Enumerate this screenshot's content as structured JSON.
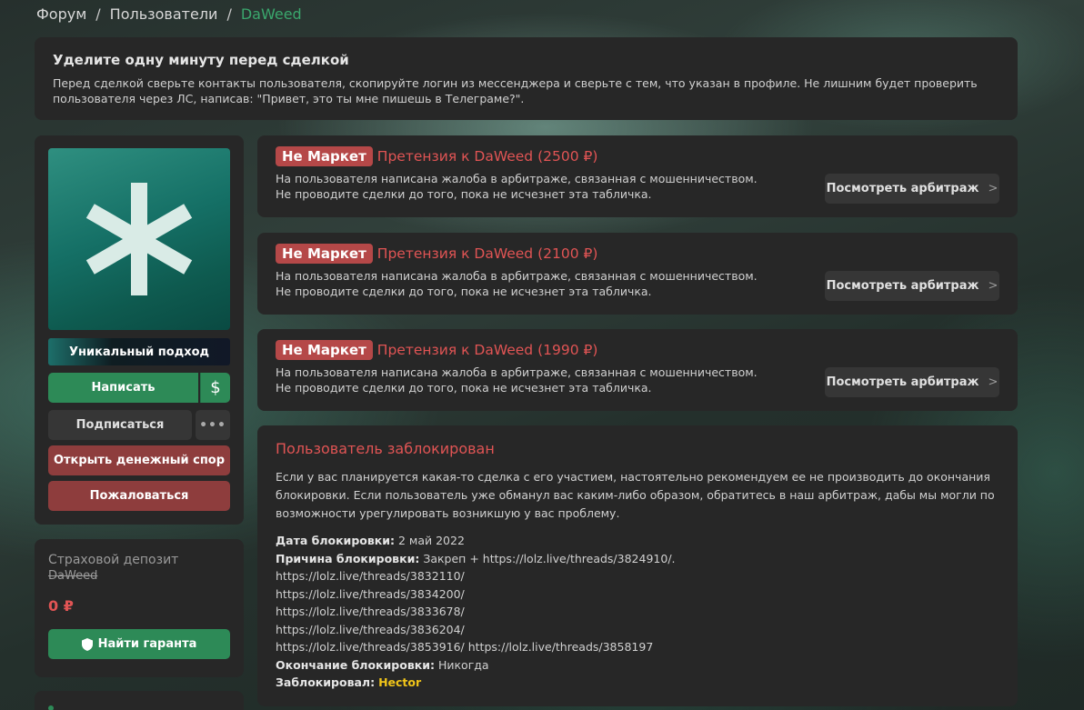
{
  "breadcrumb": {
    "items": [
      "Форум",
      "Пользователи"
    ],
    "current": "DaWeed",
    "separator": "/"
  },
  "notice": {
    "title": "Уделите одну минуту перед сделкой",
    "text": "Перед сделкой сверьте контакты пользователя, скопируйте логин из мессенджера и сверьте с тем, что указан в профиле. Не лишним будет проверить пользователя через ЛС, написав: \"Привет, это ты мне пишешь в Телеграме?\"."
  },
  "profile": {
    "user_title": "Уникальный подход",
    "write_label": "Написать",
    "dollar_label": "$",
    "subscribe_label": "Подписаться",
    "more_label": "•••",
    "dispute_label": "Открыть денежный спор",
    "report_label": "Пожаловаться"
  },
  "deposit": {
    "label": "Страховой депозит",
    "username": "DaWeed",
    "amount": "0 ₽",
    "guarant_label": "Найти гаранта"
  },
  "claims": [
    {
      "tag": "Не Маркет",
      "title": "Претензия к DaWeed (2500 ₽)",
      "line1": "На пользователя написана жалоба в арбитраже, связанная с мошенничеством.",
      "line2": "Не проводите сделки до того, пока не исчезнет эта табличка.",
      "button": "Посмотреть арбитраж"
    },
    {
      "tag": "Не Маркет",
      "title": "Претензия к DaWeed (2100 ₽)",
      "line1": "На пользователя написана жалоба в арбитраже, связанная с мошенничеством.",
      "line2": "Не проводите сделки до того, пока не исчезнет эта табличка.",
      "button": "Посмотреть арбитраж"
    },
    {
      "tag": "Не Маркет",
      "title": "Претензия к DaWeed (1990 ₽)",
      "line1": "На пользователя написана жалоба в арбитраже, связанная с мошенничеством.",
      "line2": "Не проводите сделки до того, пока не исчезнет эта табличка.",
      "button": "Посмотреть арбитраж"
    }
  ],
  "banned": {
    "title": "Пользователь заблокирован",
    "description": "Если у вас планируется какая-то сделка с его участием, настоятельно рекомендуем ее не производить до окончания блокировки. Если пользователь уже обманул вас каким-либо образом, обратитесь в наш арбитраж, дабы мы могли по возможности урегулировать возникшую у вас проблему.",
    "date_label": "Дата блокировки:",
    "date_value": "2 май 2022",
    "reason_label": "Причина блокировки:",
    "reason_first": "Закреп + https://lolz.live/threads/3824910/.",
    "reason_links": [
      "https://lolz.live/threads/3832110/",
      "https://lolz.live/threads/3834200/",
      "https://lolz.live/threads/3833678/",
      "https://lolz.live/threads/3836204/",
      "https://lolz.live/threads/3853916/ https://lolz.live/threads/3858197"
    ],
    "end_label": "Окончание блокировки:",
    "end_value": "Никогда",
    "by_label": "Заблокировал:",
    "by_value": "Hector"
  },
  "colors": {
    "accent_green": "#2d8a57",
    "danger_red": "#e05454",
    "tag_red": "#b54848",
    "moderator_gold": "#f0c419"
  }
}
